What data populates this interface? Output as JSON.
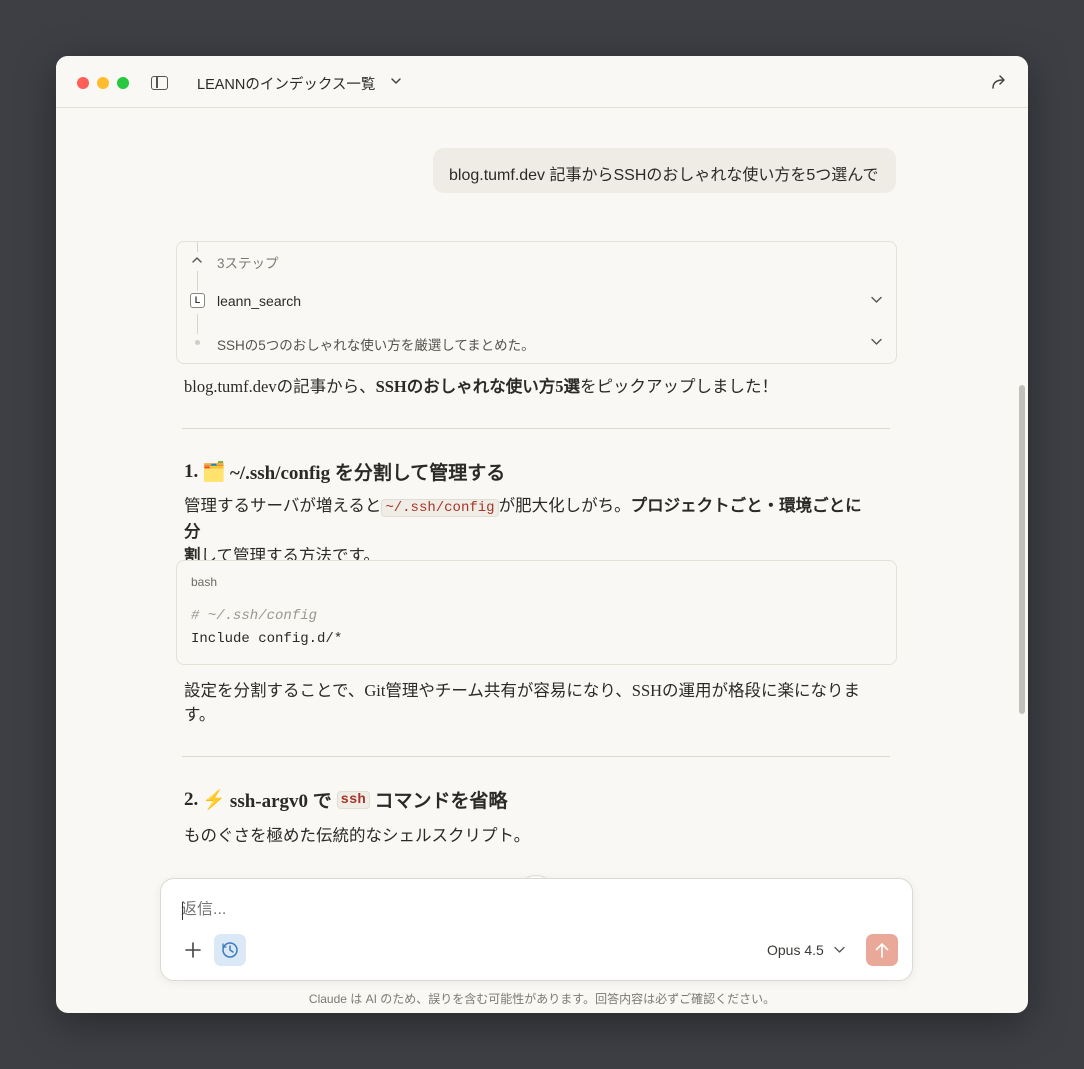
{
  "window": {
    "title": "LEANNのインデックス一覧"
  },
  "user_message": "blog.tumf.dev 記事からSSHのおしゃれな使い方を5つ選んで",
  "steps": {
    "header": "3ステップ",
    "items": [
      {
        "badge": "L",
        "label": "leann_search"
      },
      {
        "label": "SSHの5つのおしゃれな使い方を厳選してまとめた。"
      }
    ]
  },
  "response": {
    "intro_pre": "blog.tumf.devの記事から、",
    "intro_bold": "SSHのおしゃれな使い方5選",
    "intro_post": "をピックアップしました！",
    "section1": {
      "number": "1.",
      "emoji": "🗂️",
      "title": "~/.ssh/config を分割して管理する",
      "para_pre": "管理するサーバが増えると",
      "para_code": "~/.ssh/config",
      "para_mid": "が肥大化しがち。",
      "para_bold": "プロジェクトごと・環境ごとに分",
      "para_line2_bold": "割",
      "para_line2": "して管理する方法です。",
      "code_lang": "bash",
      "code_comment": "# ~/.ssh/config",
      "code_line": "Include config.d/*",
      "after_line1": "設定を分割することで、Git管理やチーム共有が容易になり、SSHの運用が格段に楽になりま",
      "after_line2": "す。"
    },
    "section2": {
      "number": "2.",
      "emoji": "⚡",
      "title_pre": "ssh-argv0 で",
      "title_code": "ssh",
      "title_post": "コマンドを省略",
      "para": "ものぐさを極めた伝統的なシェルスクリプト。"
    }
  },
  "composer": {
    "placeholder": "返信...",
    "model": "Opus 4.5"
  },
  "footer": "Claude は AI のため、誤りを含む可能性があります。回答内容は必ずご確認ください。"
}
